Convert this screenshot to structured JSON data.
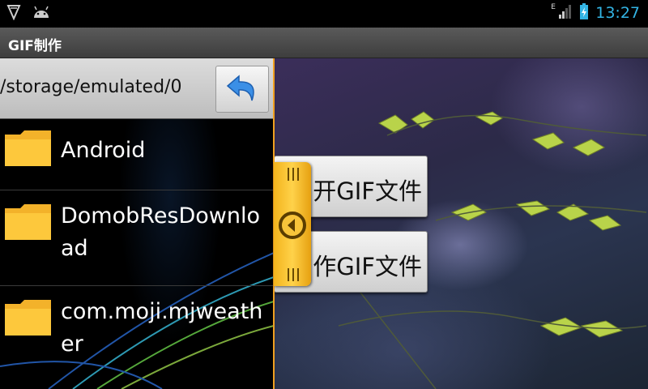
{
  "status_bar": {
    "left_icons": [
      "shield-icon",
      "android-icon"
    ],
    "network_type": "E",
    "time": "13:27"
  },
  "app": {
    "title": "GIF制作"
  },
  "file_browser": {
    "current_path": "/storage/emulated/0",
    "back_icon": "undo-arrow-icon",
    "items": [
      {
        "name": "Android",
        "icon": "folder-icon"
      },
      {
        "name": "DomobResDownload",
        "icon": "folder-icon"
      },
      {
        "name": "com.moji.mjweather",
        "icon": "folder-icon"
      }
    ]
  },
  "main": {
    "open_gif_label": "开GIF文件",
    "make_gif_label": "作GIF文件"
  },
  "drawer_handle": {
    "icon": "circle-left-arrow-icon"
  },
  "colors": {
    "accent": "#33b5e5",
    "handle": "#f5b41e",
    "title_bar": "#4a4a4a"
  }
}
